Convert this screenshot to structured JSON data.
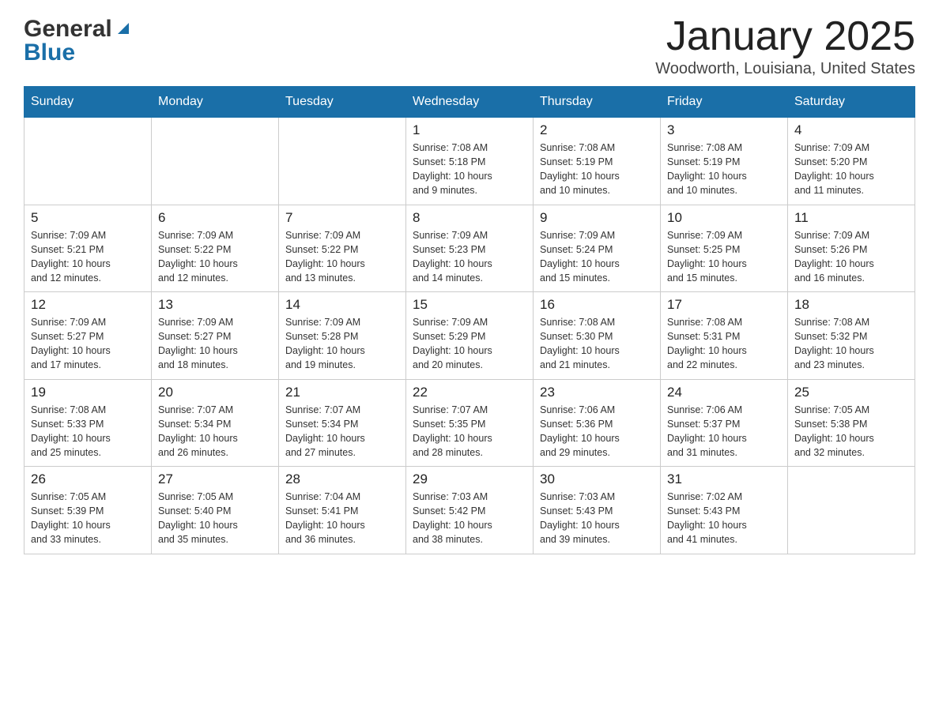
{
  "header": {
    "logo_general": "General",
    "logo_blue": "Blue",
    "month_title": "January 2025",
    "location": "Woodworth, Louisiana, United States"
  },
  "days_of_week": [
    "Sunday",
    "Monday",
    "Tuesday",
    "Wednesday",
    "Thursday",
    "Friday",
    "Saturday"
  ],
  "weeks": [
    [
      {
        "day": "",
        "info": ""
      },
      {
        "day": "",
        "info": ""
      },
      {
        "day": "",
        "info": ""
      },
      {
        "day": "1",
        "info": "Sunrise: 7:08 AM\nSunset: 5:18 PM\nDaylight: 10 hours\nand 9 minutes."
      },
      {
        "day": "2",
        "info": "Sunrise: 7:08 AM\nSunset: 5:19 PM\nDaylight: 10 hours\nand 10 minutes."
      },
      {
        "day": "3",
        "info": "Sunrise: 7:08 AM\nSunset: 5:19 PM\nDaylight: 10 hours\nand 10 minutes."
      },
      {
        "day": "4",
        "info": "Sunrise: 7:09 AM\nSunset: 5:20 PM\nDaylight: 10 hours\nand 11 minutes."
      }
    ],
    [
      {
        "day": "5",
        "info": "Sunrise: 7:09 AM\nSunset: 5:21 PM\nDaylight: 10 hours\nand 12 minutes."
      },
      {
        "day": "6",
        "info": "Sunrise: 7:09 AM\nSunset: 5:22 PM\nDaylight: 10 hours\nand 12 minutes."
      },
      {
        "day": "7",
        "info": "Sunrise: 7:09 AM\nSunset: 5:22 PM\nDaylight: 10 hours\nand 13 minutes."
      },
      {
        "day": "8",
        "info": "Sunrise: 7:09 AM\nSunset: 5:23 PM\nDaylight: 10 hours\nand 14 minutes."
      },
      {
        "day": "9",
        "info": "Sunrise: 7:09 AM\nSunset: 5:24 PM\nDaylight: 10 hours\nand 15 minutes."
      },
      {
        "day": "10",
        "info": "Sunrise: 7:09 AM\nSunset: 5:25 PM\nDaylight: 10 hours\nand 15 minutes."
      },
      {
        "day": "11",
        "info": "Sunrise: 7:09 AM\nSunset: 5:26 PM\nDaylight: 10 hours\nand 16 minutes."
      }
    ],
    [
      {
        "day": "12",
        "info": "Sunrise: 7:09 AM\nSunset: 5:27 PM\nDaylight: 10 hours\nand 17 minutes."
      },
      {
        "day": "13",
        "info": "Sunrise: 7:09 AM\nSunset: 5:27 PM\nDaylight: 10 hours\nand 18 minutes."
      },
      {
        "day": "14",
        "info": "Sunrise: 7:09 AM\nSunset: 5:28 PM\nDaylight: 10 hours\nand 19 minutes."
      },
      {
        "day": "15",
        "info": "Sunrise: 7:09 AM\nSunset: 5:29 PM\nDaylight: 10 hours\nand 20 minutes."
      },
      {
        "day": "16",
        "info": "Sunrise: 7:08 AM\nSunset: 5:30 PM\nDaylight: 10 hours\nand 21 minutes."
      },
      {
        "day": "17",
        "info": "Sunrise: 7:08 AM\nSunset: 5:31 PM\nDaylight: 10 hours\nand 22 minutes."
      },
      {
        "day": "18",
        "info": "Sunrise: 7:08 AM\nSunset: 5:32 PM\nDaylight: 10 hours\nand 23 minutes."
      }
    ],
    [
      {
        "day": "19",
        "info": "Sunrise: 7:08 AM\nSunset: 5:33 PM\nDaylight: 10 hours\nand 25 minutes."
      },
      {
        "day": "20",
        "info": "Sunrise: 7:07 AM\nSunset: 5:34 PM\nDaylight: 10 hours\nand 26 minutes."
      },
      {
        "day": "21",
        "info": "Sunrise: 7:07 AM\nSunset: 5:34 PM\nDaylight: 10 hours\nand 27 minutes."
      },
      {
        "day": "22",
        "info": "Sunrise: 7:07 AM\nSunset: 5:35 PM\nDaylight: 10 hours\nand 28 minutes."
      },
      {
        "day": "23",
        "info": "Sunrise: 7:06 AM\nSunset: 5:36 PM\nDaylight: 10 hours\nand 29 minutes."
      },
      {
        "day": "24",
        "info": "Sunrise: 7:06 AM\nSunset: 5:37 PM\nDaylight: 10 hours\nand 31 minutes."
      },
      {
        "day": "25",
        "info": "Sunrise: 7:05 AM\nSunset: 5:38 PM\nDaylight: 10 hours\nand 32 minutes."
      }
    ],
    [
      {
        "day": "26",
        "info": "Sunrise: 7:05 AM\nSunset: 5:39 PM\nDaylight: 10 hours\nand 33 minutes."
      },
      {
        "day": "27",
        "info": "Sunrise: 7:05 AM\nSunset: 5:40 PM\nDaylight: 10 hours\nand 35 minutes."
      },
      {
        "day": "28",
        "info": "Sunrise: 7:04 AM\nSunset: 5:41 PM\nDaylight: 10 hours\nand 36 minutes."
      },
      {
        "day": "29",
        "info": "Sunrise: 7:03 AM\nSunset: 5:42 PM\nDaylight: 10 hours\nand 38 minutes."
      },
      {
        "day": "30",
        "info": "Sunrise: 7:03 AM\nSunset: 5:43 PM\nDaylight: 10 hours\nand 39 minutes."
      },
      {
        "day": "31",
        "info": "Sunrise: 7:02 AM\nSunset: 5:43 PM\nDaylight: 10 hours\nand 41 minutes."
      },
      {
        "day": "",
        "info": ""
      }
    ]
  ]
}
